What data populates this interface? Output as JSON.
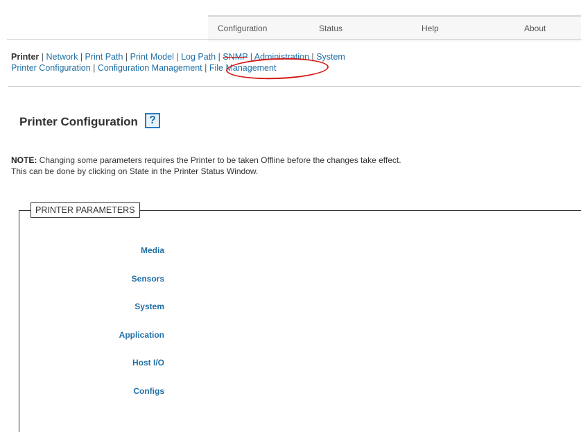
{
  "top_nav": {
    "configuration": "Configuration",
    "status": "Status",
    "help": "Help",
    "about": "About"
  },
  "sub_nav": {
    "row1": [
      "Printer",
      "Network",
      "Print Path",
      "Print Model",
      "Log Path",
      "SNMP",
      "Administration",
      "System"
    ],
    "row2": [
      "Printer Configuration",
      "Configuration Management",
      "File Management"
    ],
    "separator": " | "
  },
  "page": {
    "title": "Printer Configuration",
    "help_glyph": "?"
  },
  "note": {
    "label": "NOTE:",
    "line1": " Changing some parameters requires the Printer to be taken Offline before the changes take effect.",
    "line2": "This can be done by clicking on State in the Printer Status Window."
  },
  "params": {
    "legend": "PRINTER PARAMETERS",
    "items": [
      "Media",
      "Sensors",
      "System",
      "Application",
      "Host I/O",
      "Configs"
    ]
  },
  "colors": {
    "link": "#1f6fa6",
    "highlight": "#d41a1a"
  }
}
